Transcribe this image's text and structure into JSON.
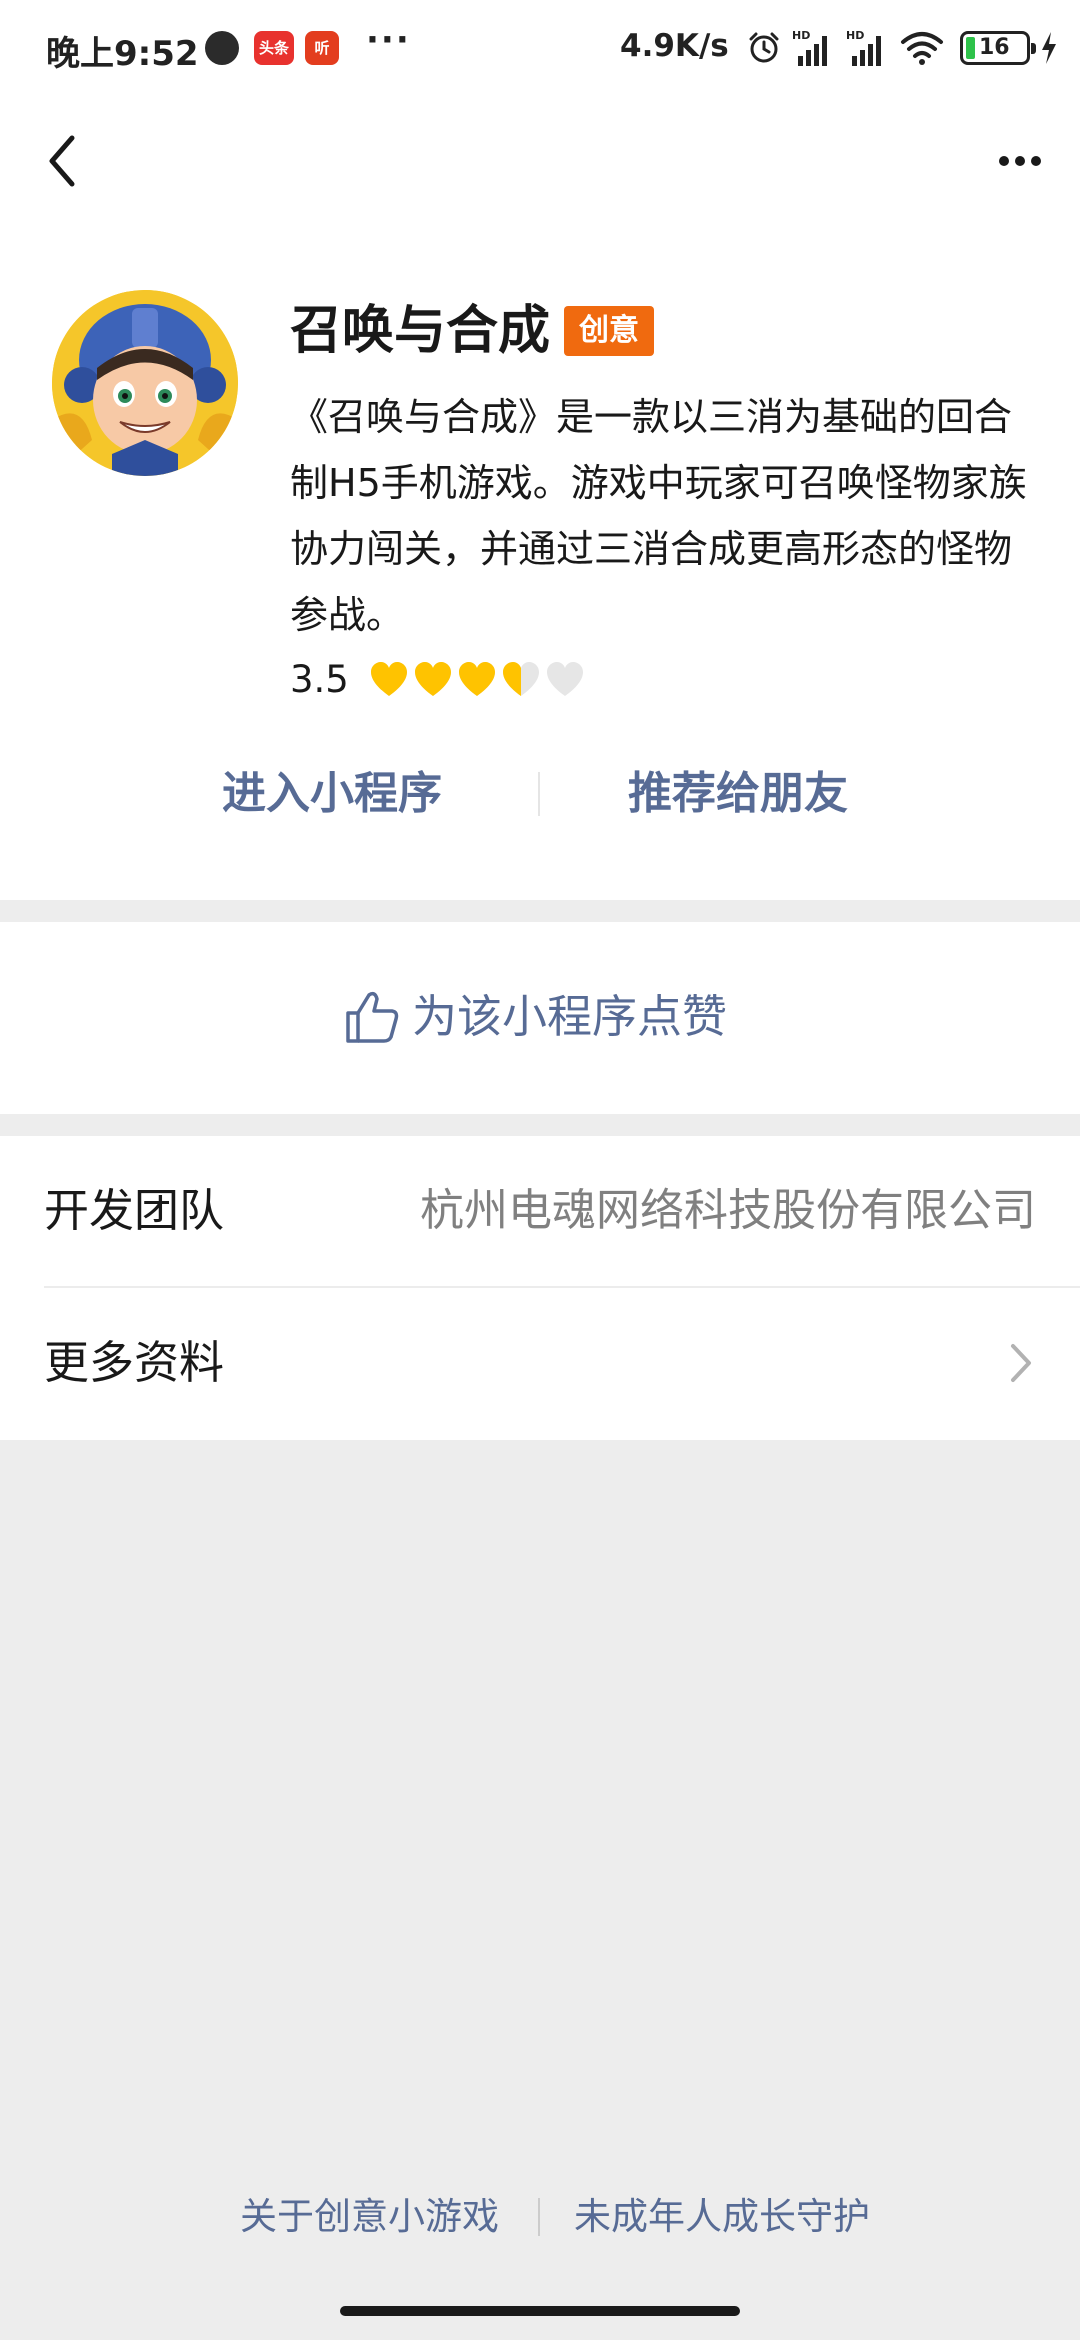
{
  "status_bar": {
    "time": "晚上9:52",
    "app_badges": [
      "",
      "头条",
      "听"
    ],
    "more_dots": "···",
    "net_speed": "4.9K/s",
    "signal_label_1": "HD",
    "signal_label_2": "HD",
    "battery": "16"
  },
  "nav": {
    "back_icon": "chevron-left-icon",
    "more_icon": "ellipsis-icon"
  },
  "profile": {
    "name": "召唤与合成",
    "tag": "创意",
    "description": "《召唤与合成》是一款以三消为基础的回合制H5手机游戏。游戏中玩家可召唤怪物家族协力闯关，并通过三消合成更高形态的怪物参战。",
    "rating": "3.5",
    "rating_value": 3.5,
    "rating_max": 5,
    "heart_color": "#ffc300",
    "heart_empty_color": "#e6e6e6",
    "actions": {
      "enter": "进入小程序",
      "share": "推荐给朋友"
    }
  },
  "like": {
    "label": "为该小程序点赞",
    "icon": "thumbs-up-icon"
  },
  "info": {
    "developer_label": "开发团队",
    "developer_value": "杭州电魂网络科技股份有限公司",
    "more_label": "更多资料"
  },
  "footer": {
    "about": "关于创意小游戏",
    "minor_protection": "未成年人成长守护"
  },
  "colors": {
    "link": "#576b95",
    "tag_bg": "#f06a0f",
    "page_bg": "#ededed"
  }
}
